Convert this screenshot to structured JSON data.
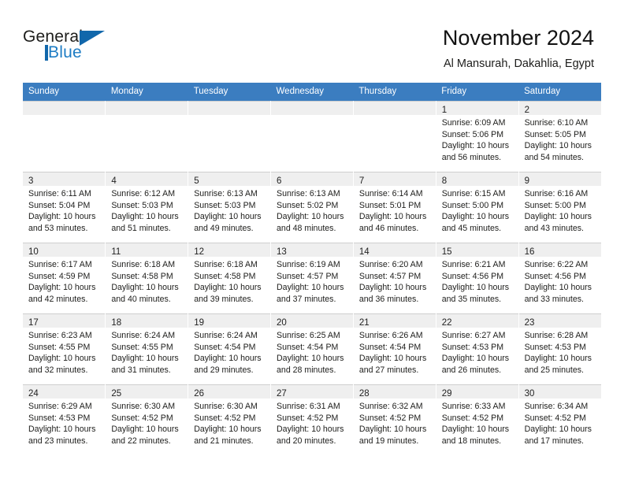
{
  "brand": {
    "name_part1": "General",
    "name_part2": "Blue",
    "logo_icon": "triangle-logo-icon"
  },
  "header": {
    "title": "November 2024",
    "location": "Al Mansurah, Dakahlia, Egypt"
  },
  "colors": {
    "header_blue": "#3b7dc0",
    "logo_blue": "#1167ab",
    "daynum_strip": "#efefef",
    "grid_line": "#cfcfcf"
  },
  "weekday_headers": [
    "Sunday",
    "Monday",
    "Tuesday",
    "Wednesday",
    "Thursday",
    "Friday",
    "Saturday"
  ],
  "weeks": [
    [
      {
        "day": "",
        "sunrise": "",
        "sunset": "",
        "daylight_line1": "",
        "daylight_line2": ""
      },
      {
        "day": "",
        "sunrise": "",
        "sunset": "",
        "daylight_line1": "",
        "daylight_line2": ""
      },
      {
        "day": "",
        "sunrise": "",
        "sunset": "",
        "daylight_line1": "",
        "daylight_line2": ""
      },
      {
        "day": "",
        "sunrise": "",
        "sunset": "",
        "daylight_line1": "",
        "daylight_line2": ""
      },
      {
        "day": "",
        "sunrise": "",
        "sunset": "",
        "daylight_line1": "",
        "daylight_line2": ""
      },
      {
        "day": "1",
        "sunrise": "Sunrise: 6:09 AM",
        "sunset": "Sunset: 5:06 PM",
        "daylight_line1": "Daylight: 10 hours",
        "daylight_line2": "and 56 minutes."
      },
      {
        "day": "2",
        "sunrise": "Sunrise: 6:10 AM",
        "sunset": "Sunset: 5:05 PM",
        "daylight_line1": "Daylight: 10 hours",
        "daylight_line2": "and 54 minutes."
      }
    ],
    [
      {
        "day": "3",
        "sunrise": "Sunrise: 6:11 AM",
        "sunset": "Sunset: 5:04 PM",
        "daylight_line1": "Daylight: 10 hours",
        "daylight_line2": "and 53 minutes."
      },
      {
        "day": "4",
        "sunrise": "Sunrise: 6:12 AM",
        "sunset": "Sunset: 5:03 PM",
        "daylight_line1": "Daylight: 10 hours",
        "daylight_line2": "and 51 minutes."
      },
      {
        "day": "5",
        "sunrise": "Sunrise: 6:13 AM",
        "sunset": "Sunset: 5:03 PM",
        "daylight_line1": "Daylight: 10 hours",
        "daylight_line2": "and 49 minutes."
      },
      {
        "day": "6",
        "sunrise": "Sunrise: 6:13 AM",
        "sunset": "Sunset: 5:02 PM",
        "daylight_line1": "Daylight: 10 hours",
        "daylight_line2": "and 48 minutes."
      },
      {
        "day": "7",
        "sunrise": "Sunrise: 6:14 AM",
        "sunset": "Sunset: 5:01 PM",
        "daylight_line1": "Daylight: 10 hours",
        "daylight_line2": "and 46 minutes."
      },
      {
        "day": "8",
        "sunrise": "Sunrise: 6:15 AM",
        "sunset": "Sunset: 5:00 PM",
        "daylight_line1": "Daylight: 10 hours",
        "daylight_line2": "and 45 minutes."
      },
      {
        "day": "9",
        "sunrise": "Sunrise: 6:16 AM",
        "sunset": "Sunset: 5:00 PM",
        "daylight_line1": "Daylight: 10 hours",
        "daylight_line2": "and 43 minutes."
      }
    ],
    [
      {
        "day": "10",
        "sunrise": "Sunrise: 6:17 AM",
        "sunset": "Sunset: 4:59 PM",
        "daylight_line1": "Daylight: 10 hours",
        "daylight_line2": "and 42 minutes."
      },
      {
        "day": "11",
        "sunrise": "Sunrise: 6:18 AM",
        "sunset": "Sunset: 4:58 PM",
        "daylight_line1": "Daylight: 10 hours",
        "daylight_line2": "and 40 minutes."
      },
      {
        "day": "12",
        "sunrise": "Sunrise: 6:18 AM",
        "sunset": "Sunset: 4:58 PM",
        "daylight_line1": "Daylight: 10 hours",
        "daylight_line2": "and 39 minutes."
      },
      {
        "day": "13",
        "sunrise": "Sunrise: 6:19 AM",
        "sunset": "Sunset: 4:57 PM",
        "daylight_line1": "Daylight: 10 hours",
        "daylight_line2": "and 37 minutes."
      },
      {
        "day": "14",
        "sunrise": "Sunrise: 6:20 AM",
        "sunset": "Sunset: 4:57 PM",
        "daylight_line1": "Daylight: 10 hours",
        "daylight_line2": "and 36 minutes."
      },
      {
        "day": "15",
        "sunrise": "Sunrise: 6:21 AM",
        "sunset": "Sunset: 4:56 PM",
        "daylight_line1": "Daylight: 10 hours",
        "daylight_line2": "and 35 minutes."
      },
      {
        "day": "16",
        "sunrise": "Sunrise: 6:22 AM",
        "sunset": "Sunset: 4:56 PM",
        "daylight_line1": "Daylight: 10 hours",
        "daylight_line2": "and 33 minutes."
      }
    ],
    [
      {
        "day": "17",
        "sunrise": "Sunrise: 6:23 AM",
        "sunset": "Sunset: 4:55 PM",
        "daylight_line1": "Daylight: 10 hours",
        "daylight_line2": "and 32 minutes."
      },
      {
        "day": "18",
        "sunrise": "Sunrise: 6:24 AM",
        "sunset": "Sunset: 4:55 PM",
        "daylight_line1": "Daylight: 10 hours",
        "daylight_line2": "and 31 minutes."
      },
      {
        "day": "19",
        "sunrise": "Sunrise: 6:24 AM",
        "sunset": "Sunset: 4:54 PM",
        "daylight_line1": "Daylight: 10 hours",
        "daylight_line2": "and 29 minutes."
      },
      {
        "day": "20",
        "sunrise": "Sunrise: 6:25 AM",
        "sunset": "Sunset: 4:54 PM",
        "daylight_line1": "Daylight: 10 hours",
        "daylight_line2": "and 28 minutes."
      },
      {
        "day": "21",
        "sunrise": "Sunrise: 6:26 AM",
        "sunset": "Sunset: 4:54 PM",
        "daylight_line1": "Daylight: 10 hours",
        "daylight_line2": "and 27 minutes."
      },
      {
        "day": "22",
        "sunrise": "Sunrise: 6:27 AM",
        "sunset": "Sunset: 4:53 PM",
        "daylight_line1": "Daylight: 10 hours",
        "daylight_line2": "and 26 minutes."
      },
      {
        "day": "23",
        "sunrise": "Sunrise: 6:28 AM",
        "sunset": "Sunset: 4:53 PM",
        "daylight_line1": "Daylight: 10 hours",
        "daylight_line2": "and 25 minutes."
      }
    ],
    [
      {
        "day": "24",
        "sunrise": "Sunrise: 6:29 AM",
        "sunset": "Sunset: 4:53 PM",
        "daylight_line1": "Daylight: 10 hours",
        "daylight_line2": "and 23 minutes."
      },
      {
        "day": "25",
        "sunrise": "Sunrise: 6:30 AM",
        "sunset": "Sunset: 4:52 PM",
        "daylight_line1": "Daylight: 10 hours",
        "daylight_line2": "and 22 minutes."
      },
      {
        "day": "26",
        "sunrise": "Sunrise: 6:30 AM",
        "sunset": "Sunset: 4:52 PM",
        "daylight_line1": "Daylight: 10 hours",
        "daylight_line2": "and 21 minutes."
      },
      {
        "day": "27",
        "sunrise": "Sunrise: 6:31 AM",
        "sunset": "Sunset: 4:52 PM",
        "daylight_line1": "Daylight: 10 hours",
        "daylight_line2": "and 20 minutes."
      },
      {
        "day": "28",
        "sunrise": "Sunrise: 6:32 AM",
        "sunset": "Sunset: 4:52 PM",
        "daylight_line1": "Daylight: 10 hours",
        "daylight_line2": "and 19 minutes."
      },
      {
        "day": "29",
        "sunrise": "Sunrise: 6:33 AM",
        "sunset": "Sunset: 4:52 PM",
        "daylight_line1": "Daylight: 10 hours",
        "daylight_line2": "and 18 minutes."
      },
      {
        "day": "30",
        "sunrise": "Sunrise: 6:34 AM",
        "sunset": "Sunset: 4:52 PM",
        "daylight_line1": "Daylight: 10 hours",
        "daylight_line2": "and 17 minutes."
      }
    ]
  ]
}
